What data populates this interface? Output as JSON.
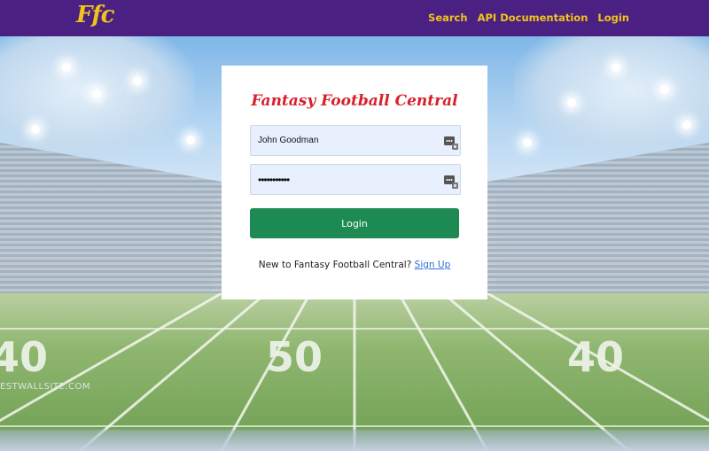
{
  "nav": {
    "brand": "Ffc",
    "links": [
      "Search",
      "API Documentation",
      "Login"
    ]
  },
  "login": {
    "title": "Fantasy Football Central",
    "username_value": "John Goodman",
    "password_value": "•••••••••••",
    "button_label": "Login",
    "signup_prompt": "New to Fantasy Football Central?",
    "signup_link": "Sign Up"
  },
  "background": {
    "yard_numbers": [
      "40",
      "50",
      "40"
    ],
    "watermark": "ESTWALLSITE.COM"
  },
  "colors": {
    "navbar": "#4a2182",
    "nav_text": "#f2c21b",
    "title_red": "#d8202a",
    "button_green": "#1d8a53",
    "input_bg": "#e8f0fe",
    "link_blue": "#2a6fd6"
  }
}
